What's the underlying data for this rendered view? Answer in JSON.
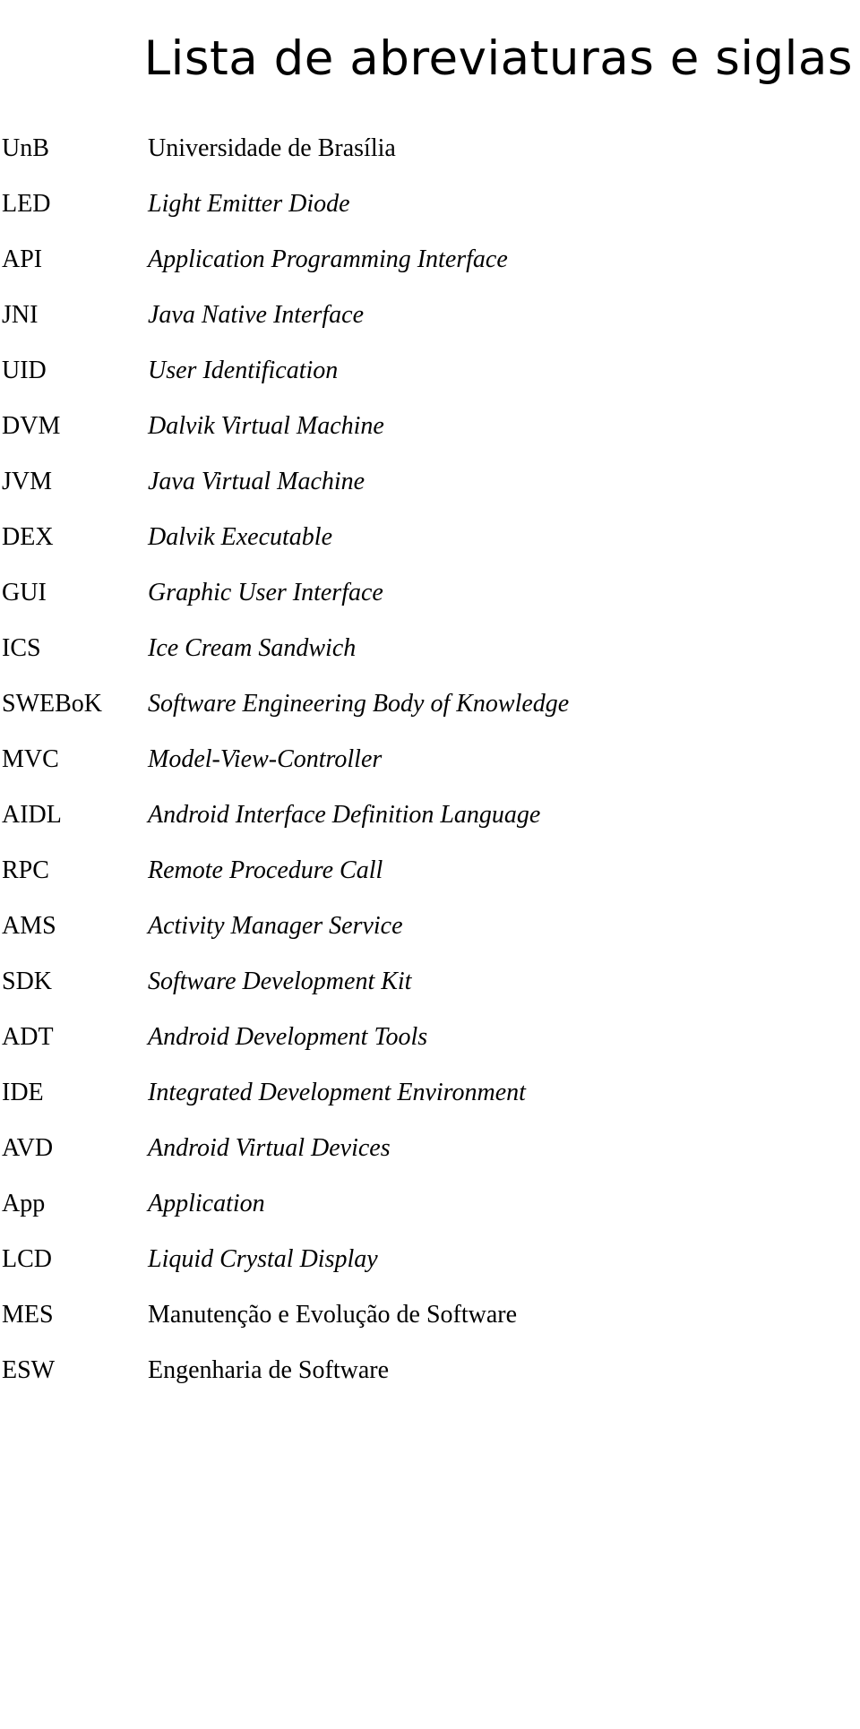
{
  "document": {
    "title": "Lista de abreviaturas e siglas",
    "entries": [
      {
        "term": "UnB",
        "definition": "Universidade de Brasília",
        "italic": false
      },
      {
        "term": "LED",
        "definition": "Light Emitter Diode",
        "italic": true
      },
      {
        "term": "API",
        "definition": "Application Programming Interface",
        "italic": true
      },
      {
        "term": "JNI",
        "definition": "Java Native Interface",
        "italic": true
      },
      {
        "term": "UID",
        "definition": "User Identification",
        "italic": true
      },
      {
        "term": "DVM",
        "definition": "Dalvik Virtual Machine",
        "italic": true
      },
      {
        "term": "JVM",
        "definition": "Java Virtual Machine",
        "italic": true
      },
      {
        "term": "DEX",
        "definition": "Dalvik Executable",
        "italic": true
      },
      {
        "term": "GUI",
        "definition": "Graphic User Interface",
        "italic": true
      },
      {
        "term": "ICS",
        "definition": "Ice Cream Sandwich",
        "italic": true
      },
      {
        "term": "SWEBoK",
        "definition": "Software Engineering Body of Knowledge",
        "italic": true
      },
      {
        "term": "MVC",
        "definition": "Model-View-Controller",
        "italic": true
      },
      {
        "term": "AIDL",
        "definition": "Android Interface Definition Language",
        "italic": true
      },
      {
        "term": "RPC",
        "definition": "Remote Procedure Call",
        "italic": true
      },
      {
        "term": "AMS",
        "definition": "Activity Manager Service",
        "italic": true
      },
      {
        "term": "SDK",
        "definition": "Software Development Kit",
        "italic": true
      },
      {
        "term": "ADT",
        "definition": "Android Development Tools",
        "italic": true
      },
      {
        "term": "IDE",
        "definition": "Integrated Development Environment",
        "italic": true
      },
      {
        "term": "AVD",
        "definition": "Android Virtual Devices",
        "italic": true
      },
      {
        "term": "App",
        "definition": "Application",
        "italic": true
      },
      {
        "term": "LCD",
        "definition": "Liquid Crystal Display",
        "italic": true
      },
      {
        "term": "MES",
        "definition": "Manutenção e Evolução de Software",
        "italic": false
      },
      {
        "term": "ESW",
        "definition": "Engenharia de Software",
        "italic": false
      }
    ]
  }
}
